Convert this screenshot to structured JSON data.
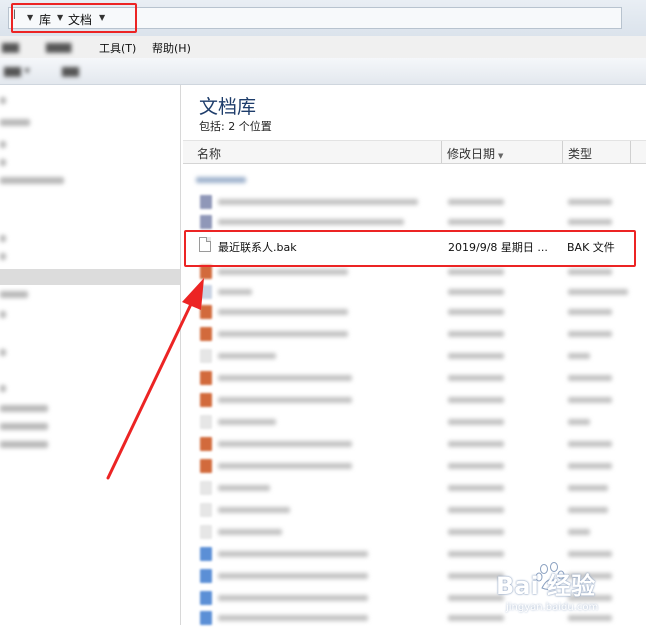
{
  "breadcrumb": {
    "items": [
      "库",
      "文档"
    ]
  },
  "menubar": {
    "items": [
      "工具(T)",
      "帮助(H)"
    ]
  },
  "library": {
    "title": "文档库",
    "subtitle": "包括: 2 个位置"
  },
  "columns": {
    "name": "名称",
    "date": "修改日期",
    "type": "类型"
  },
  "highlighted_file": {
    "name": "最近联系人.bak",
    "date": "2019/9/8 星期日 ...",
    "type": "BAK 文件"
  },
  "watermark": {
    "main": "Bai 经验",
    "sub": "jingyan.baidu.com"
  },
  "colors": {
    "annotation_red": "#ec2424",
    "title_blue": "#1e3d6b",
    "png_icon": "#d26a3c",
    "picture_icon": "#5b8fd6"
  },
  "icons": {
    "file": "file-icon",
    "watermark": "baidu-paw-icon"
  }
}
